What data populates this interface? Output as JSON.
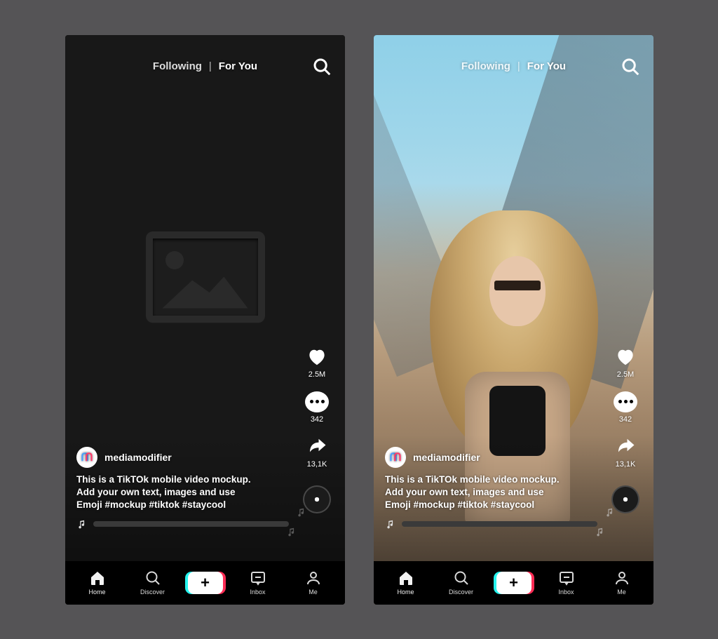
{
  "header": {
    "following": "Following",
    "separator": "|",
    "foryou": "For You"
  },
  "actions": {
    "likes": "2.5M",
    "comments": "342",
    "shares": "13,1K"
  },
  "post": {
    "username": "mediamodifier",
    "caption_line1": "This is a TikTOk mobile video mockup.",
    "caption_line2": "Add your own text, images and use",
    "caption_line3": "Emoji    #mockup #tiktok #staycool"
  },
  "nav": {
    "home": "Home",
    "discover": "Discover",
    "inbox": "Inbox",
    "me": "Me"
  }
}
